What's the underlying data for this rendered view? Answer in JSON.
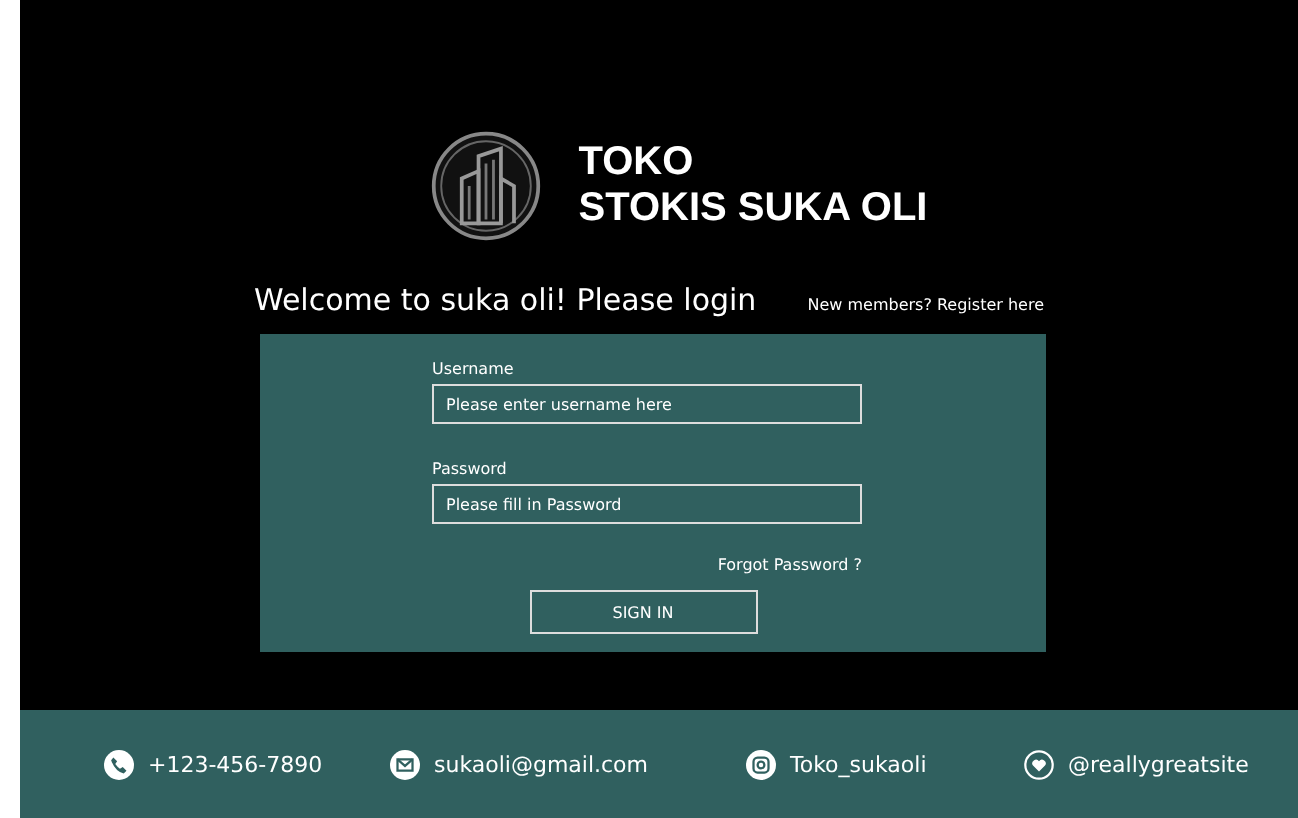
{
  "brand": {
    "line_1": "TOKO",
    "line_2": "STOKIS SUKA OLI"
  },
  "welcome": "Welcome to suka oli! Please login",
  "register_link": "New members? Register here",
  "form": {
    "fields": [
      {
        "label": "Username",
        "placeholder": "Please enter username here"
      },
      {
        "label": "Password",
        "placeholder": "Please fill in Password"
      }
    ],
    "forgot_link": "Forgot Password ?",
    "submit": "SIGN IN"
  },
  "footer": [
    {
      "kind": "phone",
      "text": "+123-456-7890"
    },
    {
      "kind": "mail",
      "text": "sukaoli@gmail.com"
    },
    {
      "kind": "instagram",
      "text": "Toko_sukaoli"
    },
    {
      "kind": "heart",
      "text": "@reallygreatsite"
    }
  ]
}
